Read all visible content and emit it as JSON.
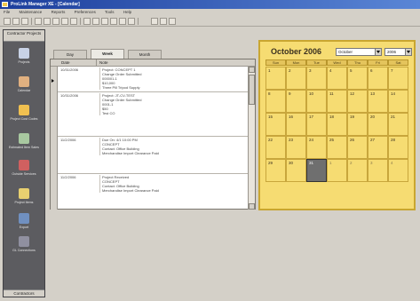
{
  "app": {
    "title": "ProLink Manager XE - [Calendar]"
  },
  "menu": [
    "File",
    "Maintenance",
    "Reports",
    "Preferences",
    "Tools",
    "Help"
  ],
  "nav": {
    "header": "Contractor Projects",
    "footer": "Contractors",
    "items": [
      {
        "label": "Projects",
        "icon": "tools-icon",
        "color": "#c8d2e6"
      },
      {
        "label": "Calendar",
        "icon": "calendar-icon",
        "color": "#e0b080"
      },
      {
        "label": "Project Cost Codes",
        "icon": "cost-codes-icon",
        "color": "#f0c050"
      },
      {
        "label": "Estimated Item Sales",
        "icon": "estimate-icon",
        "color": "#a8c8a0"
      },
      {
        "label": "Outside Services",
        "icon": "services-icon",
        "color": "#d06060"
      },
      {
        "label": "Project Items",
        "icon": "items-icon",
        "color": "#e8d070"
      },
      {
        "label": "Export",
        "icon": "export-icon",
        "color": "#7090c0"
      },
      {
        "label": "GL Connections",
        "icon": "connections-icon",
        "color": "#9090a0"
      }
    ]
  },
  "tabs": [
    "Day",
    "Week",
    "Month"
  ],
  "active_tab": "Week",
  "notes": {
    "columns": [
      "Date",
      "Note"
    ],
    "rows": [
      {
        "date": "10/31/2006",
        "lines": [
          "Project: CONCEPT 1",
          "Change Order Submitted",
          "000001-1",
          "$10,000",
          "Three Pill Tripod Supply"
        ]
      },
      {
        "date": "10/31/2006",
        "lines": [
          "Project: JT-CV-TEST",
          "Change Order Submitted",
          "0001-1",
          "$50",
          "Test CO"
        ]
      },
      {
        "date": "11/2/2006",
        "lines": [
          "Due On: 4/1 10:00 PM",
          "CONCEPT",
          "Contact: Office Building",
          "Merchandise Import Clearance Paid"
        ]
      },
      {
        "date": "11/2/2006",
        "lines": [
          "Project Received",
          "CONCEPT",
          "Contact: Office Building",
          "Merchandise Import Clearance Paid"
        ]
      }
    ]
  },
  "calendar": {
    "title": "October 2006",
    "month_select": "October",
    "year_select": "2006",
    "weekdays": [
      "Sun",
      "Mon",
      "Tue",
      "Wed",
      "Thu",
      "Fri",
      "Sat"
    ],
    "accent": "#f6dc72",
    "weeks": [
      [
        "1",
        "2",
        "3",
        "4",
        "5",
        "6",
        "7"
      ],
      [
        "8",
        "9",
        "10",
        "11",
        "12",
        "13",
        "14"
      ],
      [
        "15",
        "16",
        "17",
        "18",
        "19",
        "20",
        "21"
      ],
      [
        "22",
        "23",
        "24",
        "25",
        "26",
        "27",
        "28"
      ],
      [
        "29",
        "30",
        "31",
        "1",
        "2",
        "3",
        "4"
      ]
    ],
    "selected_day": "31"
  }
}
